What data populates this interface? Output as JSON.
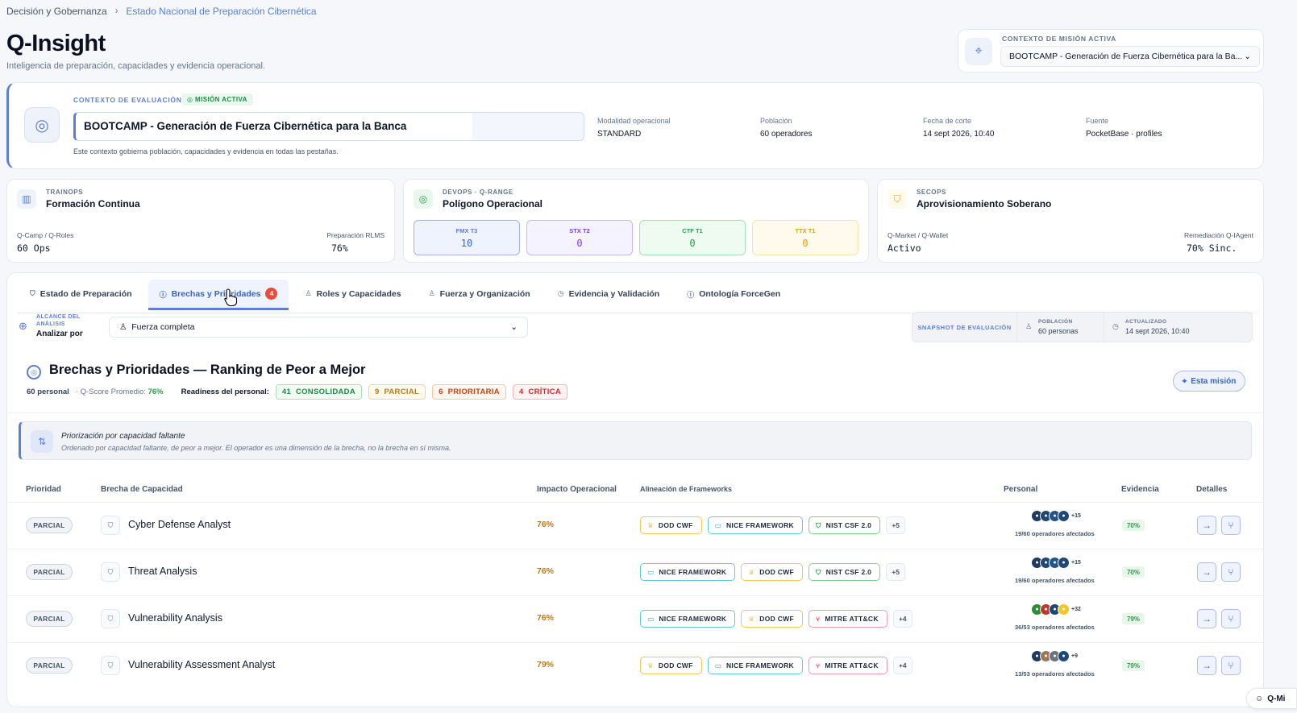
{
  "breadcrumb": {
    "parent": "Decisión y Gobernanza",
    "current": "Estado Nacional de Preparación Cibernética"
  },
  "header": {
    "title": "Q-Insight",
    "subtitle": "Inteligencia de preparación, capacidades y evidencia operacional."
  },
  "mission_context": {
    "label": "CONTEXTO DE MISIÓN ACTIVA",
    "selected": "BOOTCAMP - Generación de Fuerza Cibernética para la Ba..."
  },
  "evaluation": {
    "label": "CONTEXTO DE EVALUACIÓN",
    "badge": "MISIÓN ACTIVA",
    "name": "BOOTCAMP - Generación de Fuerza Cibernética para la Banca",
    "hint": "Este contexto gobierna población, capacidades y evidencia en todas las pestañas.",
    "meta": [
      {
        "k": "Modalidad operacional",
        "v": "STANDARD"
      },
      {
        "k": "Población",
        "v": "60 operadores"
      },
      {
        "k": "Fecha de corte",
        "v": "14 sept 2026, 10:40"
      },
      {
        "k": "Fuente",
        "v": "PocketBase · profiles"
      }
    ]
  },
  "ops": {
    "trainops": {
      "k": "TRAINOPS",
      "t": "Formación Continua",
      "l1": "Q-Camp / Q-Roles",
      "v1": "60 Ops",
      "l2": "Preparación RLMS",
      "v2": "76%"
    },
    "devops": {
      "k": "DEVOPS · Q-RANGE",
      "t": "Polígono Operacional",
      "ranges": [
        {
          "l": "FMX T3",
          "v": "10"
        },
        {
          "l": "STX T2",
          "v": "0"
        },
        {
          "l": "CTF T1",
          "v": "0"
        },
        {
          "l": "TTX T1",
          "v": "0"
        }
      ]
    },
    "secops": {
      "k": "SECOPS",
      "t": "Aprovisionamiento Soberano",
      "l1": "Q-Market / Q-Wallet",
      "v1": "Activo",
      "l2": "Remediación Q-IAgent",
      "v2": "70% Sinc."
    }
  },
  "tabs": [
    {
      "label": "Estado de Preparación"
    },
    {
      "label": "Brechas y Prioridades",
      "count": "4"
    },
    {
      "label": "Roles y Capacidades"
    },
    {
      "label": "Fuerza y Organización"
    },
    {
      "label": "Evidencia y Validación"
    },
    {
      "label": "Ontología ForceGen"
    }
  ],
  "scope": {
    "k": "ALCANCE DEL ANÁLISIS",
    "v": "Analizar por",
    "selected": "Fuerza completa"
  },
  "snapshot": {
    "label": "SNAPSHOT DE EVALUACIÓN",
    "pop_k": "POBLACIÓN",
    "pop_v": "60 personas",
    "upd_k": "ACTUALIZADO",
    "upd_v": "14 sept 2026, 10:40"
  },
  "section": {
    "title": "Brechas y Prioridades — Ranking de Peor a Mejor",
    "personal": "60 personal",
    "qscore_label": "· Q-Score Promedio:",
    "qscore": "76%",
    "readiness_label": "Readiness del personal:",
    "pills": [
      {
        "n": "41",
        "l": "CONSOLIDADA"
      },
      {
        "n": "9",
        "l": "PARCIAL"
      },
      {
        "n": "6",
        "l": "PRIORITARIA"
      },
      {
        "n": "4",
        "l": "CRÍTICA"
      }
    ],
    "scope_button": "Esta misión"
  },
  "info": {
    "title": "Priorización por capacidad faltante",
    "text": "Ordenado por capacidad faltante, de peor a mejor. El operador es una dimensión de la brecha, no la brecha en sí misma."
  },
  "table": {
    "headers": [
      "Prioridad",
      "Brecha de Capacidad",
      "Impacto Operacional",
      "Alineación de Frameworks",
      "Personal",
      "Evidencia",
      "Detalles"
    ],
    "rows": [
      {
        "prio": "PARCIAL",
        "cap": "Cyber Defense Analyst",
        "impact": "76%",
        "fw": [
          "DOD CWF",
          "NICE FRAMEWORK",
          "NIST CSF 2.0"
        ],
        "more": "+5",
        "av_more": "+15",
        "affected": "19/60 operadores afectados",
        "ev": "70%"
      },
      {
        "prio": "PARCIAL",
        "cap": "Threat Analysis",
        "impact": "76%",
        "fw": [
          "NICE FRAMEWORK",
          "DOD CWF",
          "NIST CSF 2.0"
        ],
        "more": "+5",
        "av_more": "+15",
        "affected": "19/60 operadores afectados",
        "ev": "70%"
      },
      {
        "prio": "PARCIAL",
        "cap": "Vulnerability Analysis",
        "impact": "76%",
        "fw": [
          "NICE FRAMEWORK",
          "DOD CWF",
          "MITRE ATT&CK"
        ],
        "more": "+4",
        "av_more": "+32",
        "affected": "36/53 operadores afectados",
        "ev": "79%"
      },
      {
        "prio": "PARCIAL",
        "cap": "Vulnerability Assessment Analyst",
        "impact": "79%",
        "fw": [
          "DOD CWF",
          "NICE FRAMEWORK",
          "MITRE ATT&CK"
        ],
        "more": "+4",
        "av_more": "+9",
        "affected": "13/53 operadores afectados",
        "ev": "79%"
      }
    ]
  },
  "assistant": {
    "label": "Q-Mi"
  },
  "colors": {
    "accent": "#5b7fd6",
    "consolidada": "#1f8a45",
    "parcial": "#b7791f",
    "prioritaria": "#c2410c",
    "critica": "#dc2626"
  }
}
